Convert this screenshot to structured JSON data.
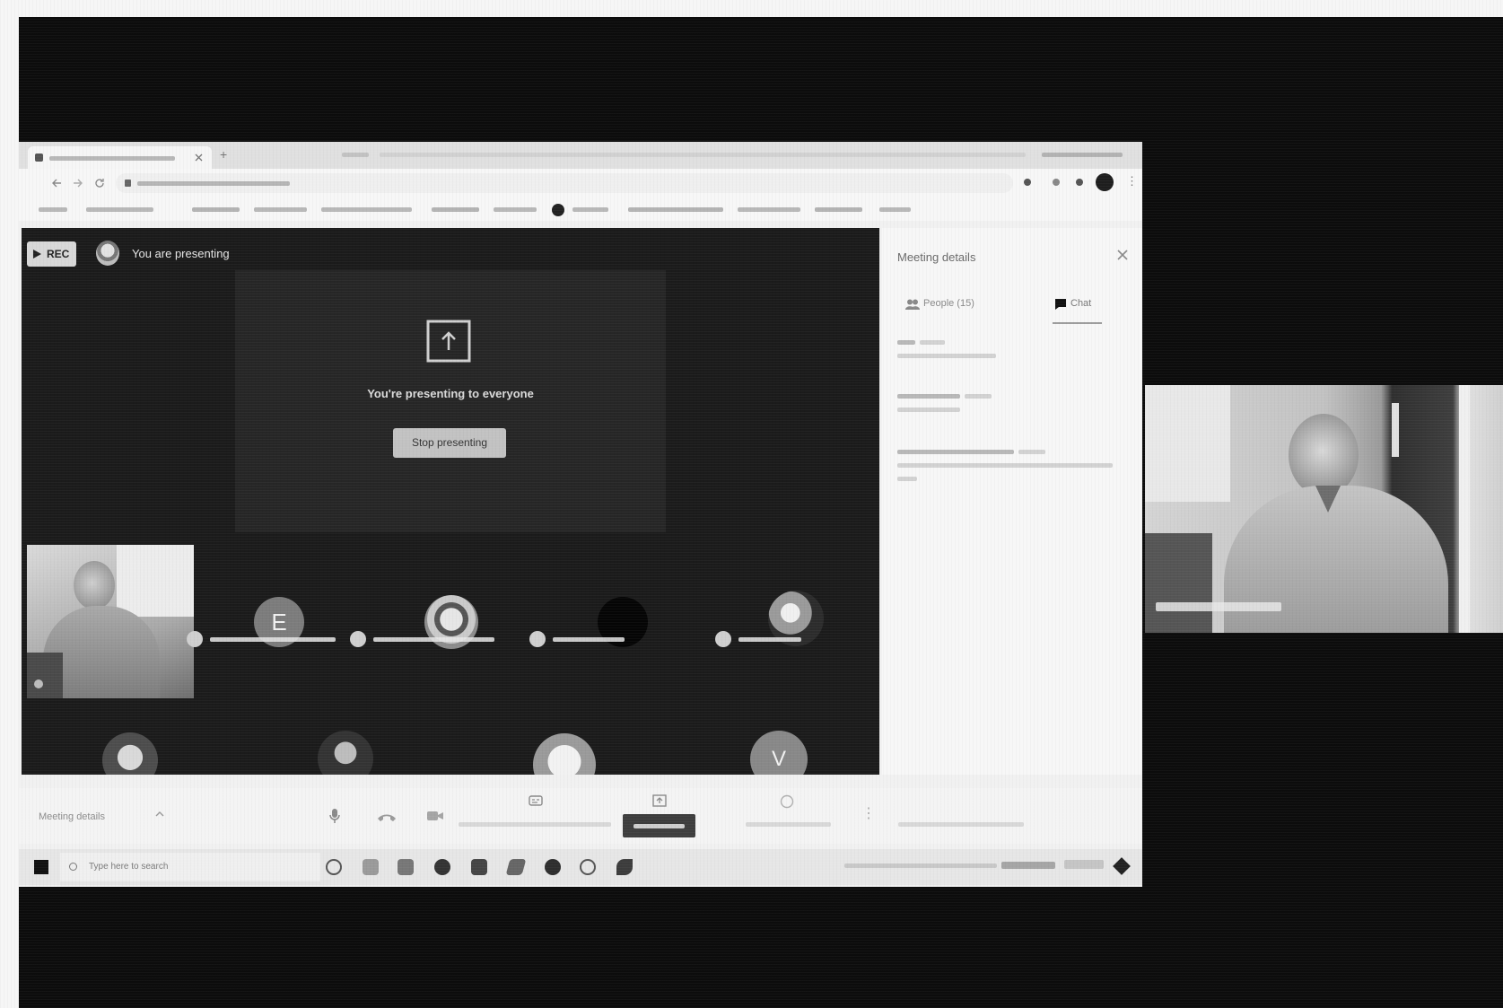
{
  "meet": {
    "stage": {
      "rec_label": "REC",
      "status_text": "You are presenting",
      "share_message": "You're presenting to everyone",
      "stop_button_label": "Stop presenting",
      "participant_initial": "E",
      "second_row_initial": "V"
    },
    "side_panel": {
      "title": "Meeting details",
      "close_icon": "close-icon",
      "tabs": [
        {
          "label": "People (15)",
          "icon": "people-icon",
          "active": false
        },
        {
          "label": "Chat",
          "icon": "chat-icon",
          "active": true
        }
      ]
    },
    "bottom_bar": {
      "details_label": "Meeting details",
      "details_icon": "chevron-up-icon",
      "controls": [
        "mic-icon",
        "hang-up-icon",
        "camera-icon",
        "captions-icon",
        "present-screen-icon",
        "raise-hand-icon",
        "more-vert-icon"
      ]
    }
  },
  "taskbar": {
    "start_icon": "windows-start-icon",
    "search_placeholder": "Type here to search"
  },
  "colors": {
    "screen": "#0c0c0c",
    "browser": "#f1f1f1",
    "stage": "#1b1b1b",
    "share_panel": "#262626",
    "stop_button": "#c2c2c2",
    "side_panel": "#f7f7f7",
    "taskbar": "#e6e6e6",
    "bottom_bar": "#f4f4f4"
  }
}
